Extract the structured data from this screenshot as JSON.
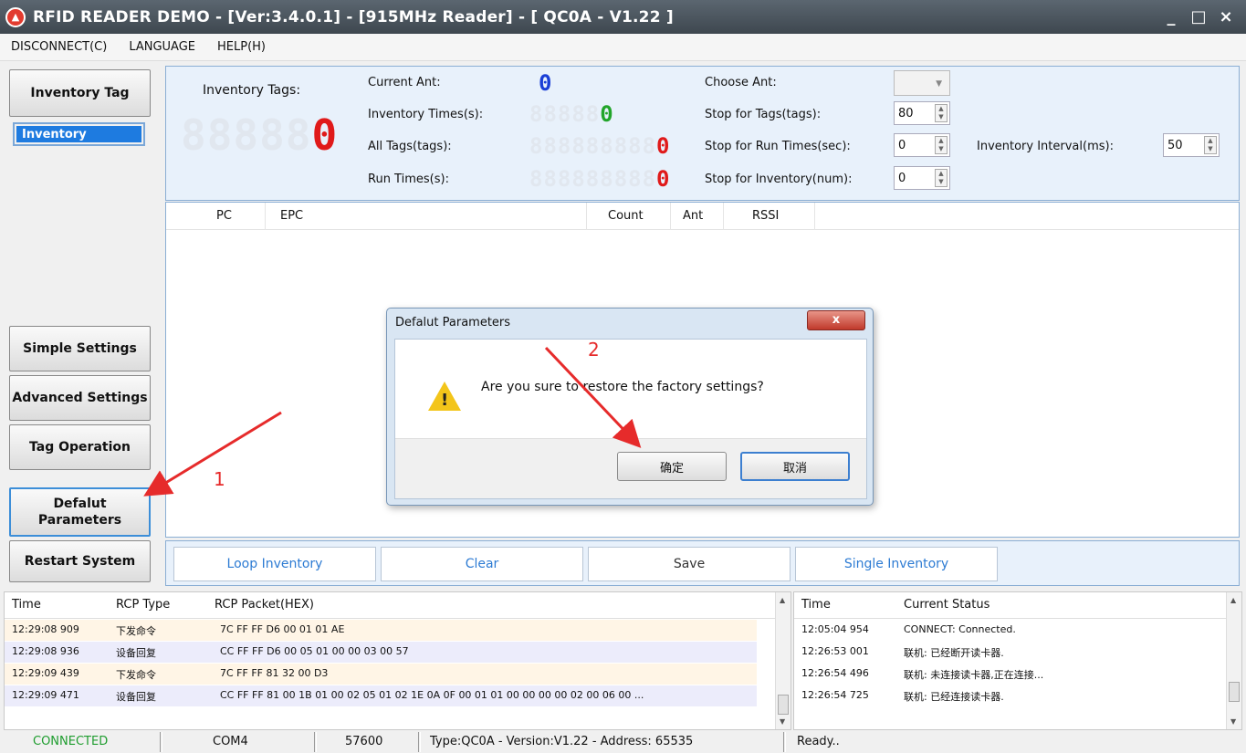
{
  "window": {
    "title": "RFID READER DEMO - [Ver:3.4.0.1] - [915MHz Reader] - [ QC0A - V1.22 ]",
    "minimize": "_",
    "maximize": "□",
    "close": "×"
  },
  "menu": [
    "DISCONNECT(C)",
    "LANGUAGE",
    "HELP(H)"
  ],
  "sidebar": {
    "inventory_tag": "Inventory Tag",
    "inventory": "Inventory",
    "simple_settings": "Simple Settings",
    "advanced_settings": "Advanced Settings",
    "tag_operation": "Tag Operation",
    "default_parameters": "Defalut Parameters",
    "restart_system": "Restart System"
  },
  "inventory_panel": {
    "inventory_tags_label": "Inventory Tags:",
    "inventory_tags_value": "0",
    "current_ant_label": "Current Ant:",
    "current_ant_value": "0",
    "inventory_times_label": "Inventory Times(s):",
    "inventory_times_value": "0",
    "all_tags_label": "All Tags(tags):",
    "all_tags_value": "0",
    "run_times_label": "Run Times(s):",
    "run_times_value": "0",
    "choose_ant_label": "Choose Ant:",
    "stop_tags_label": "Stop for Tags(tags):",
    "stop_tags_value": "80",
    "stop_run_label": "Stop for Run Times(sec):",
    "stop_run_value": "0",
    "stop_inv_label": "Stop for Inventory(num):",
    "stop_inv_value": "0",
    "interval_label": "Inventory Interval(ms):",
    "interval_value": "50"
  },
  "tag_table": {
    "columns": [
      "PC",
      "EPC",
      "Count",
      "Ant",
      "RSSI"
    ]
  },
  "buttons": {
    "loop_inventory": "Loop Inventory",
    "clear": "Clear",
    "save": "Save",
    "single_inventory": "Single Inventory"
  },
  "dialog": {
    "title": "Defalut Parameters",
    "close": "x",
    "message": "Are you sure to restore the factory settings?",
    "ok": "确定",
    "cancel": "取消"
  },
  "annotations": {
    "step1": "1",
    "step2": "2"
  },
  "rcp_log": {
    "columns": [
      "Time",
      "RCP Type",
      "RCP Packet(HEX)"
    ],
    "rows": [
      {
        "time": "12:29:08 909",
        "type": "下发命令",
        "packet": "7C FF FF D6 00 01 01 AE"
      },
      {
        "time": "12:29:08 936",
        "type": "设备回复",
        "packet": "CC FF FF D6 00 05 01 00 00 03 00 57"
      },
      {
        "time": "12:29:09 439",
        "type": "下发命令",
        "packet": "7C FF FF 81 32 00 D3"
      },
      {
        "time": "12:29:09 471",
        "type": "设备回复",
        "packet": "CC FF FF 81 00 1B 01 00 02 05 01 02 1E 0A 0F 00 01 01 00 00 00 00 02 00 06 00 ..."
      }
    ]
  },
  "status_log": {
    "columns": [
      "Time",
      "Current Status"
    ],
    "rows": [
      {
        "time": "12:05:04 954",
        "status": "CONNECT: Connected."
      },
      {
        "time": "12:26:53 001",
        "status": "联机: 已经断开读卡器."
      },
      {
        "time": "12:26:54 496",
        "status": "联机: 未连接读卡器,正在连接..."
      },
      {
        "time": "12:26:54 725",
        "status": "联机: 已经连接读卡器."
      }
    ]
  },
  "statusbar": {
    "connection": "CONNECTED",
    "port": "COM4",
    "baud": "57600",
    "device": "Type:QC0A - Version:V1.22 - Address: 65535",
    "state": "Ready.."
  },
  "colors": {
    "blue_digit": "#1a3fd6",
    "green_digit": "#22a52a",
    "red_digit": "#e01a1a",
    "connected": "#1f9d2f",
    "annotation": "#e62b2b"
  }
}
